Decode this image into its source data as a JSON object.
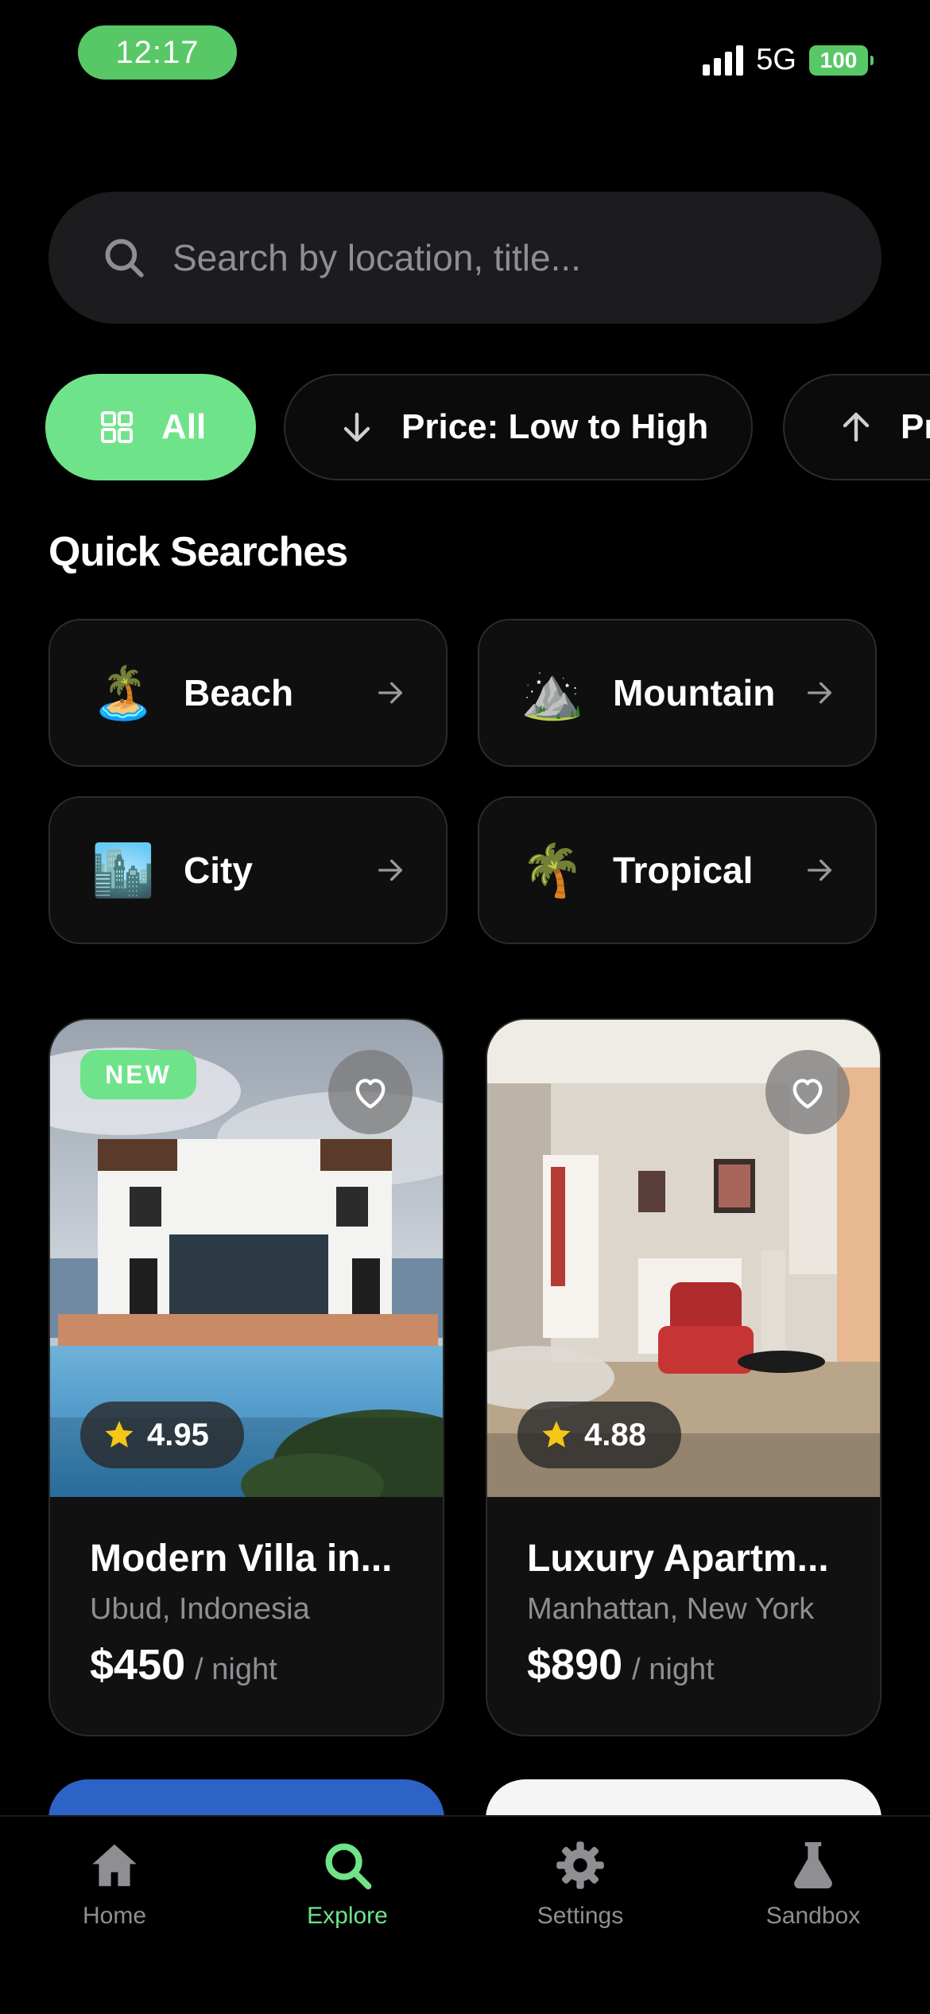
{
  "status_bar": {
    "time": "12:17",
    "network": "5G",
    "battery": "100"
  },
  "search": {
    "placeholder": "Search by location, title..."
  },
  "filters": [
    {
      "label": "All",
      "icon": "grid-icon",
      "active": true
    },
    {
      "label": "Price: Low to High",
      "icon": "arrow-down-icon"
    },
    {
      "label": "Price: High to Low",
      "icon": "arrow-up-icon"
    }
  ],
  "quick_searches": {
    "title": "Quick Searches",
    "items": [
      {
        "label": "Beach",
        "emoji": "🏝️"
      },
      {
        "label": "Mountain",
        "emoji": "⛰️"
      },
      {
        "label": "City",
        "emoji": "🏙️"
      },
      {
        "label": "Tropical",
        "emoji": "🌴"
      }
    ]
  },
  "listings": [
    {
      "badge": "NEW",
      "rating": "4.95",
      "title": "Modern Villa in...",
      "location": "Ubud, Indonesia",
      "price": "$450",
      "per": "/ night"
    },
    {
      "rating": "4.88",
      "title": "Luxury Apartm...",
      "location": "Manhattan, New York",
      "price": "$890",
      "per": "/ night"
    }
  ],
  "tabs": [
    {
      "label": "Home",
      "icon": "home-icon"
    },
    {
      "label": "Explore",
      "icon": "search-icon",
      "active": true
    },
    {
      "label": "Settings",
      "icon": "gear-icon"
    },
    {
      "label": "Sandbox",
      "icon": "flask-icon"
    }
  ],
  "colors": {
    "accent": "#6fe38a",
    "status_green": "#58c867",
    "background": "#000000",
    "surface": "#1c1c1e",
    "muted": "#8e8e93"
  }
}
